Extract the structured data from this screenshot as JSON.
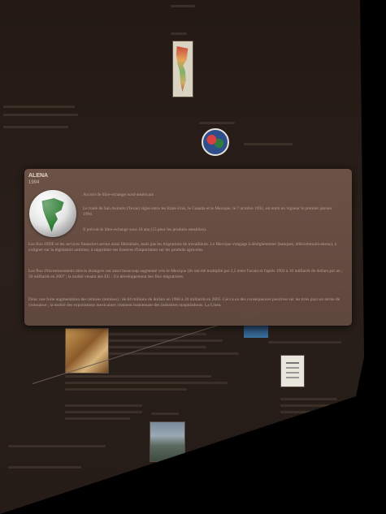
{
  "card": {
    "title": "ALENA",
    "year": "1994",
    "globe_icon": "north-america-globe-icon",
    "subtitle": "Accord de libre-échange nord-américain",
    "treaty_text": "Le traité de San Antonio (Texas) signé entre les Etats-Unis, le Canada et le Mexique, le 7 octobre 1992, est entré en vigueur le premier janvier 1994.",
    "pace_text": "Il prévoit le libre-échange sous 10 ans (15 pour les produits sensibles).",
    "flux_text_1": "Les flux d'IDE et les services financiers seront aussi libéralisés, mais pas les migrations de travailleurs. Le Mexique s'engage à déréglementer (banques, télécommunications), à s'aligner sur la législation antitrust, à supprimer ses licences d'importation sur les produits agricoles.",
    "flux_text_2": "Les flux d'investissements directs étrangers ont aussi beaucoup augmenté vers le Mexique (ils ont été multiplié par 2,5 entre l'avant et l'après 1992 à 10 milliards de dollars par an ; 20 milliards en 2007 ; la moitié venant des EU ; Un développement des flux migratoires.",
    "remises_text": "Donc une forte augmentation des remises (remises) : de 84 millions de dollars en 1960 à 20 milliards en 2005. Ceci a eu des conséquences positives sur les trois pays en terme de croissance ; la moitié des exportations mexicaines viennent maintenant des industries maquiladoras. La Linea."
  },
  "colors": {
    "background": "#000000",
    "plane": "#2a1f1a",
    "card": "#6e5448",
    "card_title": "#e2d3c6",
    "body_text": "#b8a294"
  }
}
